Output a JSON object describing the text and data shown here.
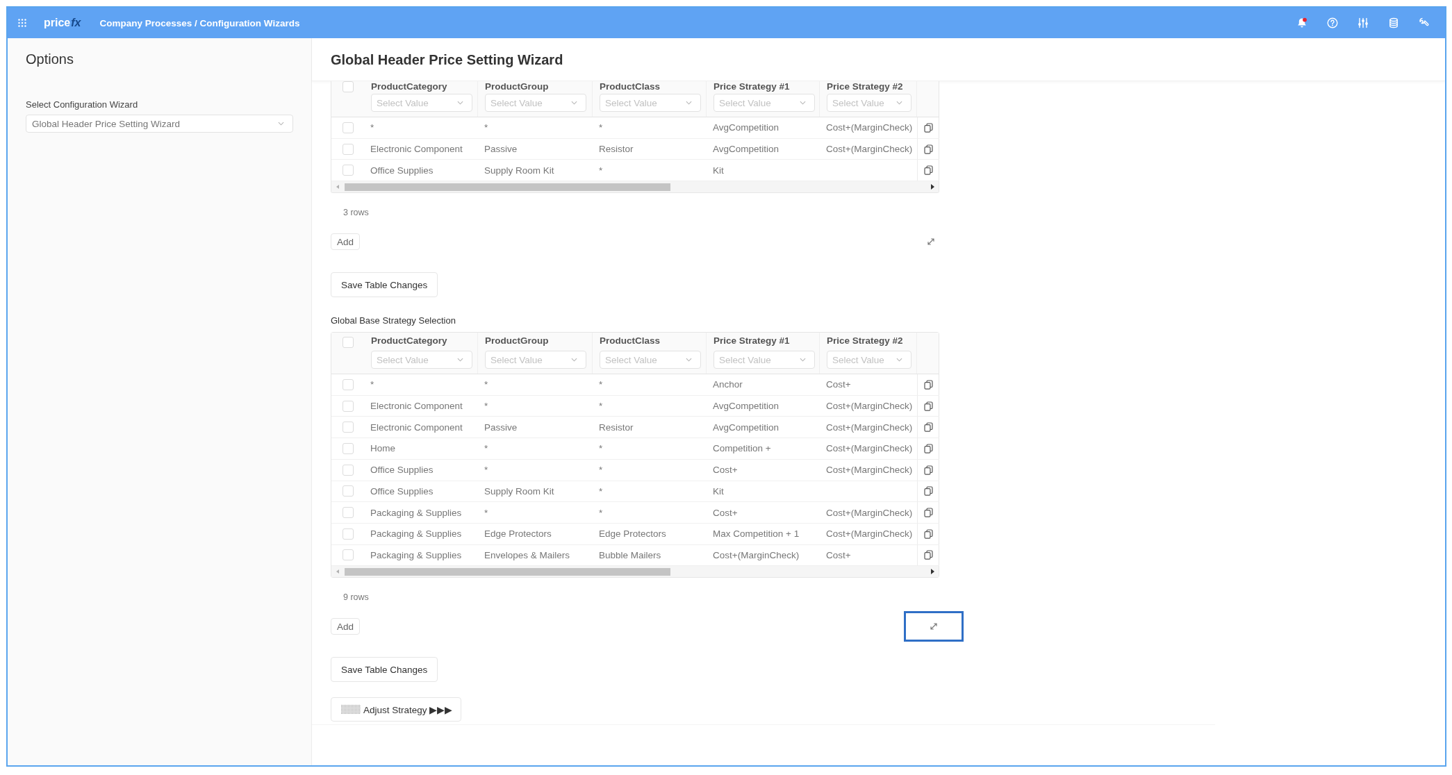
{
  "top_bar": {
    "logo": {
      "text": "price",
      "accent": "fx"
    },
    "breadcrumb": "Company Processes / Configuration Wizards",
    "notifications_unread": true
  },
  "options_panel": {
    "title": "Options",
    "wizard_select": {
      "label": "Select Configuration Wizard",
      "value": "Global Header Price Setting Wizard"
    }
  },
  "page": {
    "title": "Global Header Price Setting Wizard"
  },
  "tables": [
    {
      "header_checked": false,
      "columns": [
        {
          "label": "ProductCategory",
          "filter_placeholder": "Select Value"
        },
        {
          "label": "ProductGroup",
          "filter_placeholder": "Select Value"
        },
        {
          "label": "ProductClass",
          "filter_placeholder": "Select Value"
        },
        {
          "label": "Price Strategy #1",
          "filter_placeholder": "Select Value"
        },
        {
          "label": "Price Strategy #2",
          "filter_placeholder": "Select Value"
        }
      ],
      "rows": [
        {
          "checked": false,
          "product_category": "*",
          "product_group": "*",
          "product_class": "*",
          "price_strategy_1": "AvgCompetition",
          "price_strategy_2": "Cost+(MarginCheck)"
        },
        {
          "checked": false,
          "product_category": "Electronic Component",
          "product_group": "Passive",
          "product_class": "Resistor",
          "price_strategy_1": "AvgCompetition",
          "price_strategy_2": "Cost+(MarginCheck)"
        },
        {
          "checked": false,
          "product_category": "Office Supplies",
          "product_group": "Supply Room Kit",
          "product_class": "*",
          "price_strategy_1": "Kit"
        }
      ],
      "row_count": "3 rows",
      "add_button": "Add",
      "expand_focused": false,
      "save_button": "Save Table Changes"
    },
    {
      "title": "Global Base Strategy Selection",
      "header_checked": false,
      "columns": [
        {
          "label": "ProductCategory",
          "filter_placeholder": "Select Value"
        },
        {
          "label": "ProductGroup",
          "filter_placeholder": "Select Value"
        },
        {
          "label": "ProductClass",
          "filter_placeholder": "Select Value"
        },
        {
          "label": "Price Strategy #1",
          "filter_placeholder": "Select Value"
        },
        {
          "label": "Price Strategy #2",
          "filter_placeholder": "Select Value"
        }
      ],
      "rows": [
        {
          "checked": false,
          "product_category": "*",
          "product_group": "*",
          "product_class": "*",
          "price_strategy_1": "Anchor",
          "price_strategy_2": "Cost+"
        },
        {
          "checked": false,
          "product_category": "Electronic Component",
          "product_group": "*",
          "product_class": "*",
          "price_strategy_1": "AvgCompetition",
          "price_strategy_2": "Cost+(MarginCheck)"
        },
        {
          "checked": false,
          "product_category": "Electronic Component",
          "product_group": "Passive",
          "product_class": "Resistor",
          "price_strategy_1": "AvgCompetition",
          "price_strategy_2": "Cost+(MarginCheck)"
        },
        {
          "checked": false,
          "product_category": "Home",
          "product_group": "*",
          "product_class": "*",
          "price_strategy_1": "Competition +",
          "price_strategy_2": "Cost+(MarginCheck)"
        },
        {
          "checked": false,
          "product_category": "Office Supplies",
          "product_group": "*",
          "product_class": "*",
          "price_strategy_1": "Cost+",
          "price_strategy_2": "Cost+(MarginCheck)"
        },
        {
          "checked": false,
          "product_category": "Office Supplies",
          "product_group": "Supply Room Kit",
          "product_class": "*",
          "price_strategy_1": "Kit"
        },
        {
          "checked": false,
          "product_category": "Packaging & Supplies",
          "product_group": "*",
          "product_class": "*",
          "price_strategy_1": "Cost+",
          "price_strategy_2": "Cost+(MarginCheck)"
        },
        {
          "checked": false,
          "product_category": "Packaging & Supplies",
          "product_group": "Edge Protectors",
          "product_class": "Edge Protectors",
          "price_strategy_1": "Max Competition + 1",
          "price_strategy_2": "Cost+(MarginCheck)"
        },
        {
          "checked": false,
          "product_category": "Packaging & Supplies",
          "product_group": "Envelopes & Mailers",
          "product_class": "Bubble Mailers",
          "price_strategy_1": "Cost+(MarginCheck)",
          "price_strategy_2": "Cost+"
        }
      ],
      "row_count": "9 rows",
      "add_button": "Add",
      "expand_focused": true,
      "save_button": "Save Table Changes"
    }
  ],
  "adjust_button": {
    "label": "Adjust Strategy ▶▶▶"
  }
}
